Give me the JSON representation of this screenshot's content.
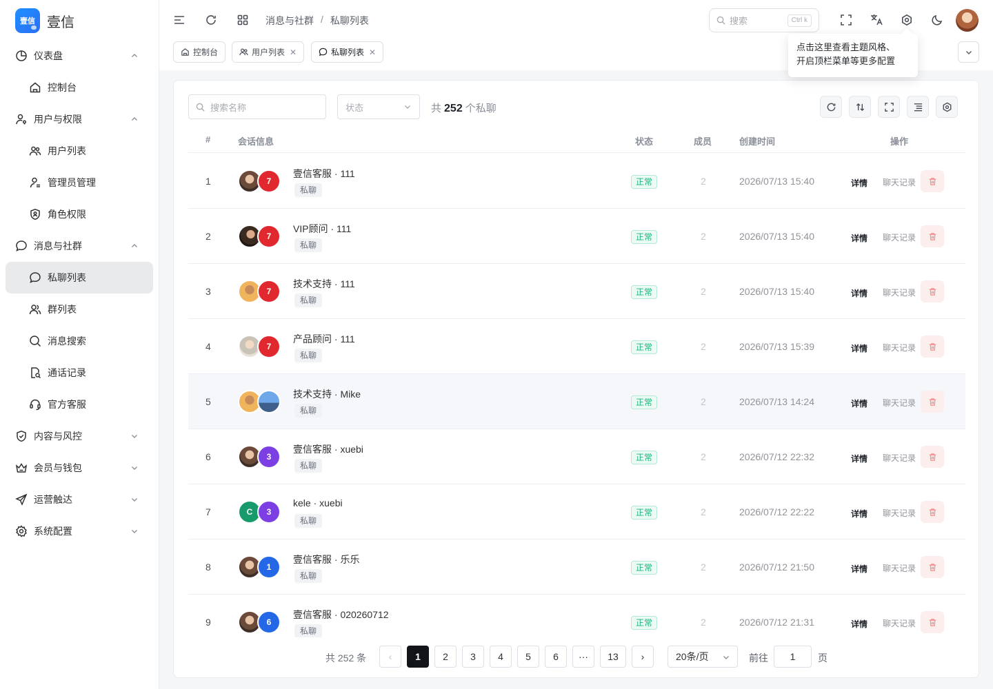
{
  "colors": {
    "accent": "#111418",
    "status_ok": "#16b67f",
    "danger": "#f28b8b",
    "avatar_red": "#e0282e",
    "avatar_purple": "#7b3fe4",
    "avatar_blue": "#2468e8",
    "avatar_green": "#179b6a"
  },
  "brand": {
    "logo_text": "壹信",
    "name": "壹信"
  },
  "sidebar": {
    "items": [
      {
        "label": "仪表盘",
        "icon": "pie-chart-icon",
        "level": "group",
        "expanded": true
      },
      {
        "label": "控制台",
        "icon": "home-icon",
        "level": "sub"
      },
      {
        "label": "用户与权限",
        "icon": "user-key-icon",
        "level": "group",
        "expanded": true
      },
      {
        "label": "用户列表",
        "icon": "users-icon",
        "level": "sub"
      },
      {
        "label": "管理员管理",
        "icon": "admin-icon",
        "level": "sub"
      },
      {
        "label": "角色权限",
        "icon": "shield-user-icon",
        "level": "sub"
      },
      {
        "label": "消息与社群",
        "icon": "chat-icon",
        "level": "group",
        "expanded": true
      },
      {
        "label": "私聊列表",
        "icon": "chat-bubble-icon",
        "level": "sub",
        "active": true
      },
      {
        "label": "群列表",
        "icon": "group-icon",
        "level": "sub"
      },
      {
        "label": "消息搜索",
        "icon": "search-icon",
        "level": "sub"
      },
      {
        "label": "通话记录",
        "icon": "call-log-icon",
        "level": "sub"
      },
      {
        "label": "官方客服",
        "icon": "headset-icon",
        "level": "sub"
      },
      {
        "label": "内容与风控",
        "icon": "shield-check-icon",
        "level": "group",
        "expanded": false
      },
      {
        "label": "会员与钱包",
        "icon": "crown-icon",
        "level": "group",
        "expanded": false
      },
      {
        "label": "运营触达",
        "icon": "send-icon",
        "level": "group",
        "expanded": false
      },
      {
        "label": "系统配置",
        "icon": "gear-icon",
        "level": "group",
        "expanded": false
      }
    ]
  },
  "header": {
    "breadcrumb": [
      "消息与社群",
      "私聊列表"
    ],
    "breadcrumb_sep": "/",
    "search_placeholder": "搜索",
    "search_shortcut": "Ctrl k"
  },
  "tabs": [
    {
      "label": "控制台",
      "icon": "home-icon",
      "closable": false
    },
    {
      "label": "用户列表",
      "icon": "users-icon",
      "closable": true
    },
    {
      "label": "私聊列表",
      "icon": "chat-bubble-icon",
      "closable": true,
      "active": true
    }
  ],
  "tooltip": {
    "line1_pre": "点击这里查看",
    "line1_bold": "主题风格",
    "line1_post": "、",
    "line2_pre": "开启",
    "line2_bold": "顶栏菜单",
    "line2_post": "等更多配置"
  },
  "filters": {
    "name_placeholder": "搜索名称",
    "status_placeholder": "状态",
    "total_prefix": "共",
    "total_count": "252",
    "total_suffix": "个私聊"
  },
  "table": {
    "columns": [
      "#",
      "会话信息",
      "状态",
      "成员",
      "创建时间",
      "操作"
    ],
    "action_detail": "详情",
    "action_chat": "聊天记录",
    "rows": [
      {
        "idx": "1",
        "name": "壹信客服 · 111",
        "tag": "私聊",
        "status": "正常",
        "members": "2",
        "time": "2026/07/13 15:40",
        "av1": {
          "type": "photo",
          "style": "photo"
        },
        "av2": {
          "type": "letter",
          "text": "7",
          "color": "#e0282e"
        }
      },
      {
        "idx": "2",
        "name": "VIP顾问 · 111",
        "tag": "私聊",
        "status": "正常",
        "members": "2",
        "time": "2026/07/13 15:40",
        "av1": {
          "type": "photo",
          "style": "photo2"
        },
        "av2": {
          "type": "letter",
          "text": "7",
          "color": "#e0282e"
        }
      },
      {
        "idx": "3",
        "name": "技术支持 · 111",
        "tag": "私聊",
        "status": "正常",
        "members": "2",
        "time": "2026/07/13 15:40",
        "av1": {
          "type": "photo",
          "style": "photo3"
        },
        "av2": {
          "type": "letter",
          "text": "7",
          "color": "#e0282e"
        }
      },
      {
        "idx": "4",
        "name": "产品顾问 · 111",
        "tag": "私聊",
        "status": "正常",
        "members": "2",
        "time": "2026/07/13 15:39",
        "av1": {
          "type": "photo",
          "style": "photo4"
        },
        "av2": {
          "type": "letter",
          "text": "7",
          "color": "#e0282e"
        }
      },
      {
        "idx": "5",
        "name": "技术支持 · Mike",
        "tag": "私聊",
        "status": "正常",
        "members": "2",
        "time": "2026/07/13 14:24",
        "hover": true,
        "av1": {
          "type": "photo",
          "style": "photo3"
        },
        "av2": {
          "type": "photo",
          "style": "photo5"
        }
      },
      {
        "idx": "6",
        "name": "壹信客服 · xuebi",
        "tag": "私聊",
        "status": "正常",
        "members": "2",
        "time": "2026/07/12 22:32",
        "av1": {
          "type": "photo",
          "style": "photo"
        },
        "av2": {
          "type": "letter",
          "text": "3",
          "color": "#7b3fe4"
        }
      },
      {
        "idx": "7",
        "name": "kele · xuebi",
        "tag": "私聊",
        "status": "正常",
        "members": "2",
        "time": "2026/07/12 22:22",
        "av1": {
          "type": "letter",
          "text": "C",
          "color": "#179b6a"
        },
        "av2": {
          "type": "letter",
          "text": "3",
          "color": "#7b3fe4"
        }
      },
      {
        "idx": "8",
        "name": "壹信客服 · 乐乐",
        "tag": "私聊",
        "status": "正常",
        "members": "2",
        "time": "2026/07/12 21:50",
        "av1": {
          "type": "photo",
          "style": "photo"
        },
        "av2": {
          "type": "letter",
          "text": "1",
          "color": "#2468e8"
        }
      },
      {
        "idx": "9",
        "name": "壹信客服 · 020260712",
        "tag": "私聊",
        "status": "正常",
        "members": "2",
        "time": "2026/07/12 21:31",
        "av1": {
          "type": "photo",
          "style": "photo"
        },
        "av2": {
          "type": "letter",
          "text": "6",
          "color": "#2468e8"
        }
      }
    ]
  },
  "pagination": {
    "total_text": "共 252 条",
    "prev": "‹",
    "next": "›",
    "pages": [
      "1",
      "2",
      "3",
      "4",
      "5",
      "6",
      "···",
      "13"
    ],
    "current": "1",
    "page_size": "20条/页",
    "goto_label": "前往",
    "goto_value": "1",
    "goto_unit": "页"
  }
}
